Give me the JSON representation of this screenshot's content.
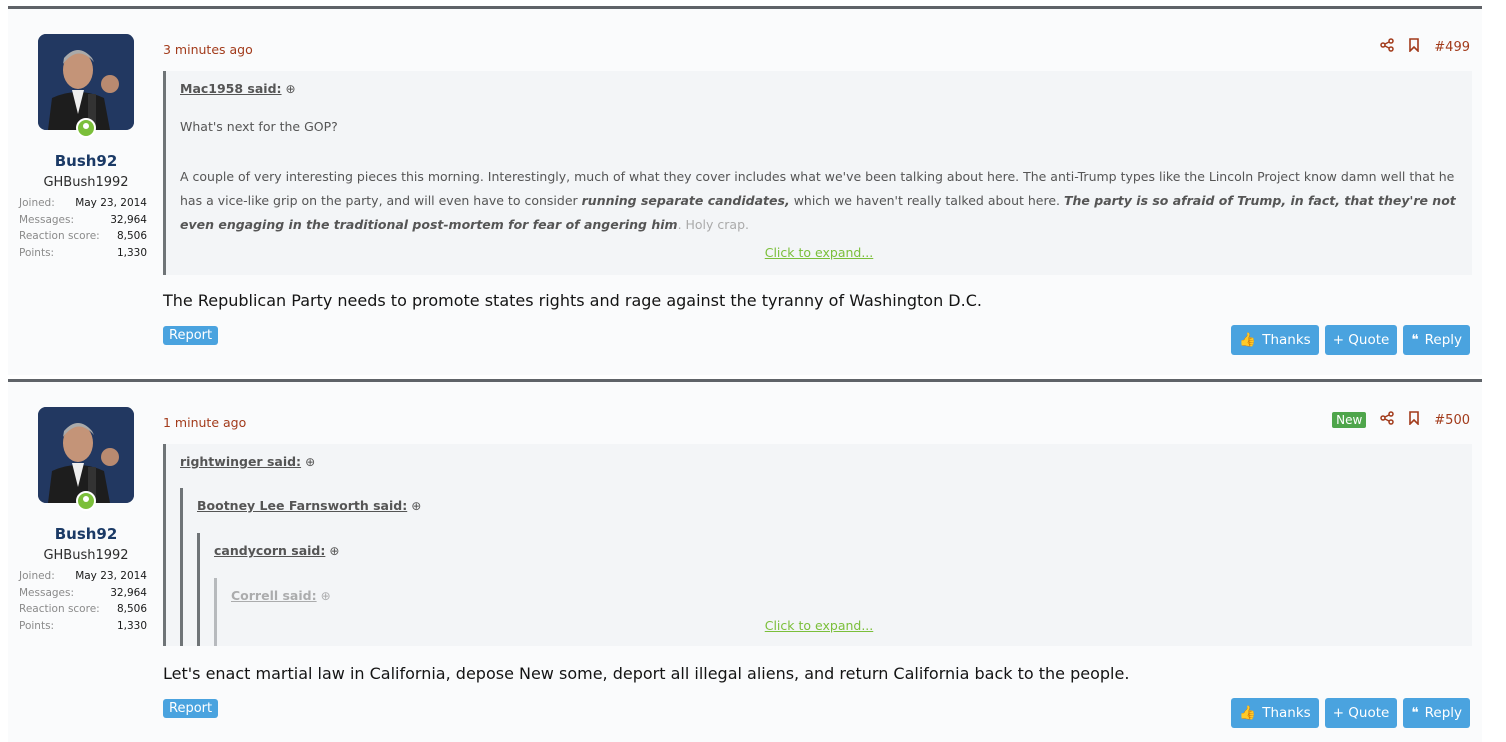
{
  "posts": [
    {
      "time": "3 minutes ago",
      "number": "#499",
      "new_badge": "",
      "user": {
        "name": "Bush92",
        "title": "GHBush1992"
      },
      "stats": [
        {
          "k": "Joined:",
          "v": "May 23, 2014"
        },
        {
          "k": "Messages:",
          "v": "32,964"
        },
        {
          "k": "Reaction score:",
          "v": "8,506"
        },
        {
          "k": "Points:",
          "v": "1,330"
        }
      ],
      "quote": {
        "author": "Mac1958 said:",
        "line1": "What's next for the GOP?",
        "p1": "A couple of very interesting pieces this morning. Interestingly, much of what they cover includes what we've been talking about here. The anti-Trump types like the Lincoln Project know damn well that he has a vice-like grip on the party, and will even have to consider",
        "bold1": "running separate candidates,",
        "p2": "which we haven't really talked about here.",
        "bold2": "The party is so afraid of Trump, in fact, that they're not even engaging in the traditional post-mortem for fear of angering him",
        "p3": ". Holy crap.",
        "expand": "Click to expand..."
      },
      "message": "The Republican Party needs to promote states rights and rage against the tyranny of Washington D.C.",
      "report": "Report",
      "buttons": {
        "thanks": "Thanks",
        "quote": "+ Quote",
        "reply": "Reply"
      }
    },
    {
      "time": "1 minute ago",
      "number": "#500",
      "new_badge": "New",
      "user": {
        "name": "Bush92",
        "title": "GHBush1992"
      },
      "stats": [
        {
          "k": "Joined:",
          "v": "May 23, 2014"
        },
        {
          "k": "Messages:",
          "v": "32,964"
        },
        {
          "k": "Reaction score:",
          "v": "8,506"
        },
        {
          "k": "Points:",
          "v": "1,330"
        }
      ],
      "quote": {
        "authors": [
          "rightwinger said:",
          "Bootney Lee Farnsworth said:",
          "candycorn said:",
          "Correll said:"
        ],
        "expand": "Click to expand..."
      },
      "message": "Let's enact martial law in California, depose New some, deport all illegal aliens, and return California back to the people.",
      "report": "Report",
      "buttons": {
        "thanks": "Thanks",
        "quote": "+ Quote",
        "reply": "Reply"
      }
    }
  ],
  "colors": {
    "accent": "#4aa3df",
    "time": "#a23b1b",
    "online": "#7bbf3a",
    "new": "#4ea54b"
  }
}
